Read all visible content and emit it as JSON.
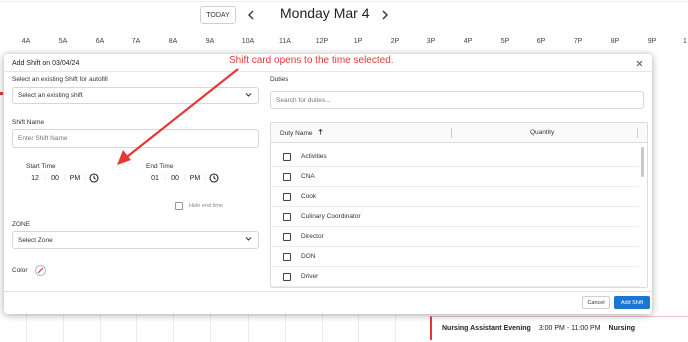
{
  "calendar": {
    "today_label": "TODAY",
    "prev_icon": "chevron-left-icon",
    "next_icon": "chevron-right-icon",
    "date_title": "Monday Mar 4",
    "hours": [
      "4A",
      "5A",
      "6A",
      "7A",
      "8A",
      "9A",
      "10A",
      "11A",
      "12P",
      "1P",
      "2P",
      "3P",
      "4P",
      "5P",
      "6P",
      "7P",
      "8P",
      "9P",
      "1"
    ],
    "event": {
      "name": "Nursing Assistant Evening",
      "time": "3:00 PM - 11:00 PM",
      "role": "Nursing",
      "accent": "#e53935"
    }
  },
  "dialog": {
    "title": "Add Shift on 03/04/24",
    "close_icon": "close-icon",
    "autofill_label": "Select an existing Shift for autofill",
    "autofill_value": "Select an existing shift",
    "shift_name_label": "Shift Name",
    "shift_name_placeholder": "Enter Shift Name",
    "start_time": {
      "label": "Start Time",
      "hour": "12",
      "minute": "00",
      "ampm": "PM"
    },
    "end_time": {
      "label": "End Time",
      "hour": "01",
      "minute": "00",
      "ampm": "PM"
    },
    "hide_end_time_label": "Hide end time",
    "zone_label": "ZONE",
    "zone_value": "Select Zone",
    "color_label": "Color",
    "duties_label": "Duties",
    "duties_search_placeholder": "Search for duties...",
    "duty_table": {
      "col_name": "Duty Name",
      "sort_icon": "arrow-up-icon",
      "col_quantity": "Quantity",
      "rows": [
        "Activities",
        "CNA",
        "Cook",
        "Culinary Coordinator",
        "Director",
        "DON",
        "Driver"
      ]
    },
    "cancel_label": "Cancel",
    "add_label": "Add Shift",
    "primary_color": "#1976d2"
  },
  "annotation": {
    "text": "Shift card opens to the time selected.",
    "color": "#e53935"
  }
}
